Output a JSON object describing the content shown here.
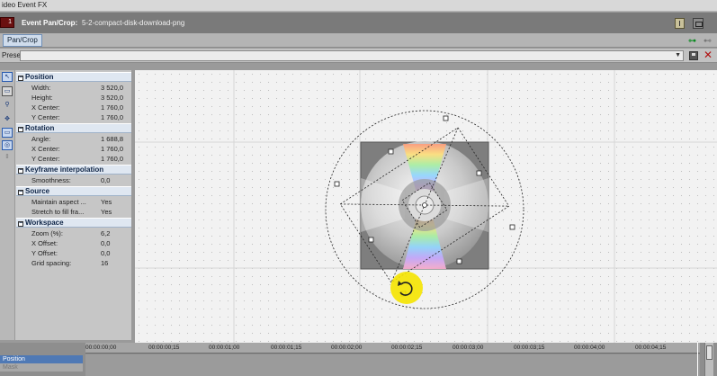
{
  "window": {
    "title": "ideo Event FX"
  },
  "event": {
    "label": "Event Pan/Crop:",
    "source": "5-2-compact-disk-download-png",
    "thumb_text": "1"
  },
  "plugin": {
    "tab": "Pan/Crop"
  },
  "preset": {
    "label": "Preset:",
    "value": ""
  },
  "props": {
    "position": {
      "header": "Position",
      "rows": [
        {
          "k": "Width:",
          "v": "3 520,0"
        },
        {
          "k": "Height:",
          "v": "3 520,0"
        },
        {
          "k": "X Center:",
          "v": "1 760,0"
        },
        {
          "k": "Y Center:",
          "v": "1 760,0"
        }
      ]
    },
    "rotation": {
      "header": "Rotation",
      "rows": [
        {
          "k": "Angle:",
          "v": "1 688,8"
        },
        {
          "k": "X Center:",
          "v": "1 760,0"
        },
        {
          "k": "Y Center:",
          "v": "1 760,0"
        }
      ]
    },
    "keyframe": {
      "header": "Keyframe interpolation",
      "rows": [
        {
          "k": "Smoothness:",
          "v": "0,0"
        }
      ]
    },
    "source": {
      "header": "Source",
      "rows": [
        {
          "k": "Maintain aspect ...",
          "v": "Yes"
        },
        {
          "k": "Stretch to fill fra...",
          "v": "Yes"
        }
      ]
    },
    "workspace": {
      "header": "Workspace",
      "rows": [
        {
          "k": "Zoom (%):",
          "v": "6,2"
        },
        {
          "k": "X Offset:",
          "v": "0,0"
        },
        {
          "k": "Y Offset:",
          "v": "0,0"
        },
        {
          "k": "Grid spacing:",
          "v": "16"
        }
      ]
    }
  },
  "timeline": {
    "ticks": [
      "00:00:00;00",
      "00:00:00;15",
      "00:00:01;00",
      "00:00:01;15",
      "00:00:02;00",
      "00:00:02;15",
      "00:00:03;00",
      "00:00:03;15",
      "00:00:04;00",
      "00:00:04;15"
    ],
    "tracks": [
      "Position",
      "Mask"
    ]
  },
  "colors": {
    "accent": "#4f79b5",
    "highlight": "#f5e400",
    "delete": "#b01010"
  }
}
